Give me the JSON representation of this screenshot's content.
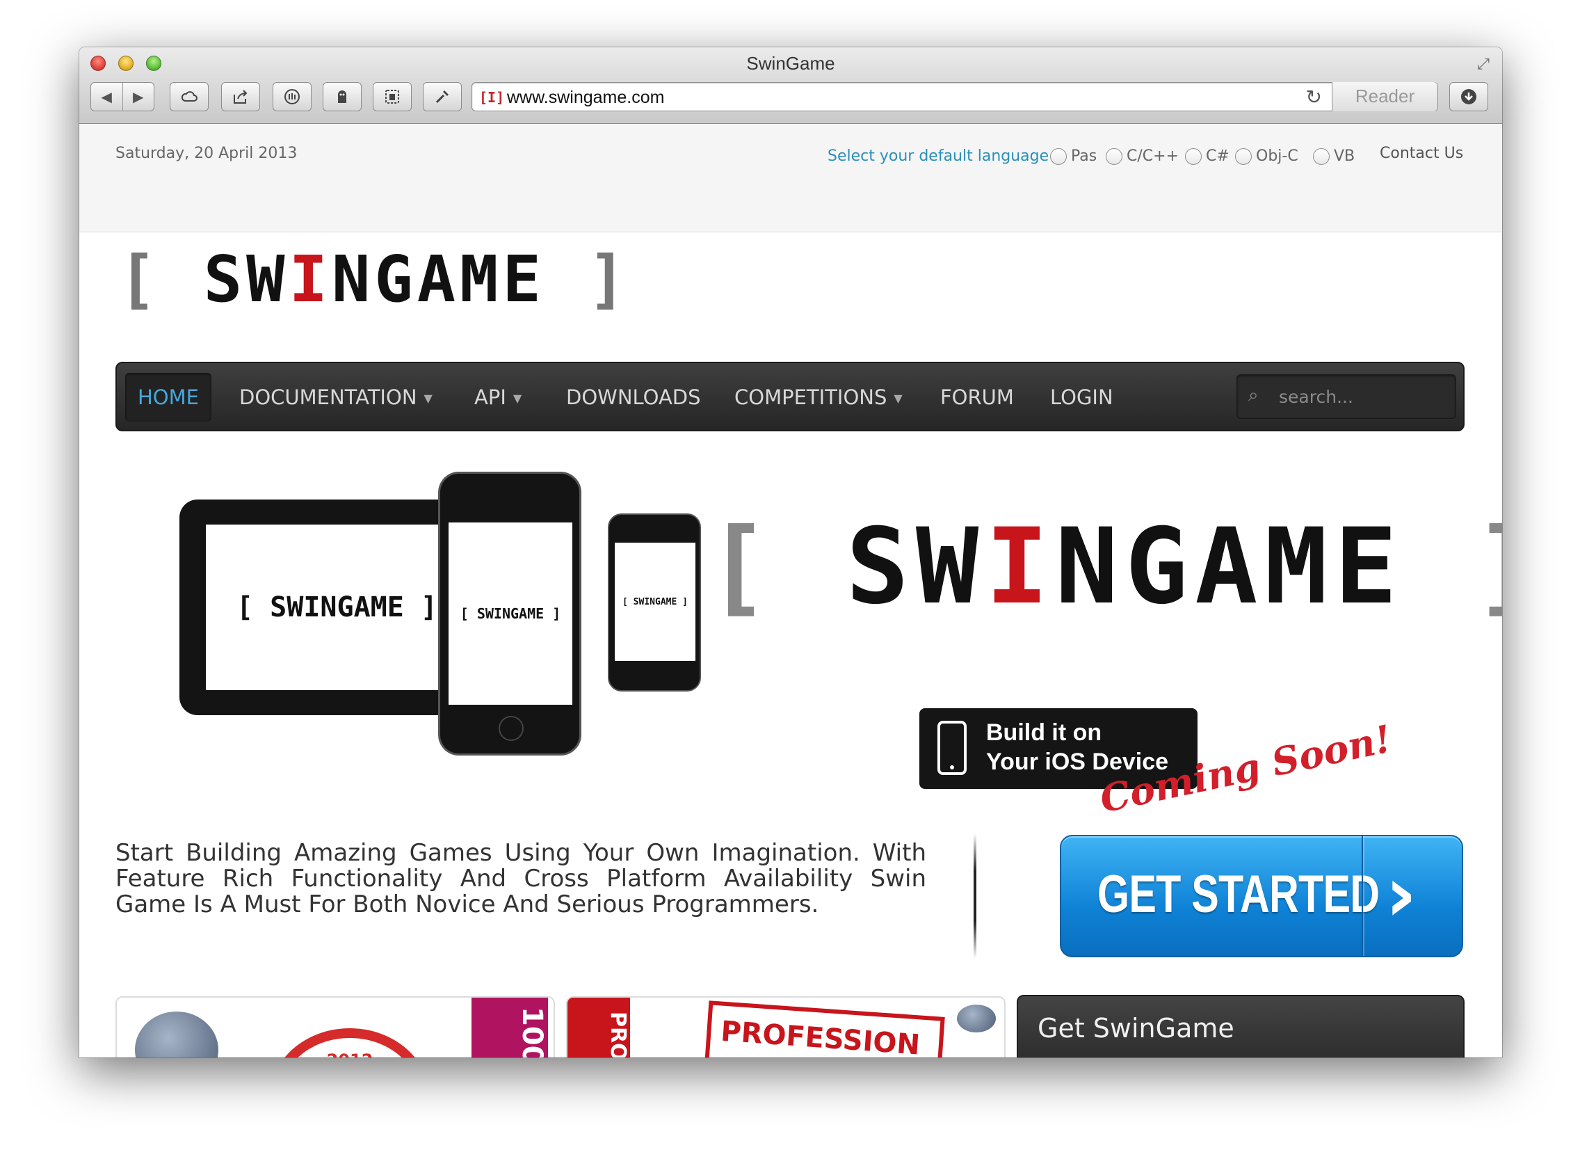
{
  "browser": {
    "window_title": "SwinGame",
    "url": "www.swingame.com",
    "favicon_text": "[I]",
    "reader_label": "Reader",
    "toolbar_icons": [
      "back-icon",
      "forward-icon",
      "icloud-icon",
      "share-icon",
      "stop-icon",
      "extension-icon",
      "evernote-icon",
      "tools-icon",
      "reload-icon",
      "downloads-icon",
      "fullscreen-icon"
    ]
  },
  "topbar": {
    "date": "Saturday, 20 April 2013",
    "language_prompt": "Select your default language",
    "languages": [
      "Pas",
      "C/C++",
      "C#",
      "Obj-C",
      "VB"
    ],
    "contact": "Contact Us"
  },
  "logo": {
    "open": "[ ",
    "part1": "SW",
    "accent": "I",
    "part2": "NGAME",
    "close": " ]"
  },
  "nav": {
    "items": [
      {
        "label": "HOME",
        "active": true,
        "dropdown": false
      },
      {
        "label": "DOCUMENTATION",
        "active": false,
        "dropdown": true
      },
      {
        "label": "API",
        "active": false,
        "dropdown": true
      },
      {
        "label": "DOWNLOADS",
        "active": false,
        "dropdown": false
      },
      {
        "label": "COMPETITIONS",
        "active": false,
        "dropdown": true
      },
      {
        "label": "FORUM",
        "active": false,
        "dropdown": false
      },
      {
        "label": "LOGIN",
        "active": false,
        "dropdown": false
      }
    ],
    "search_placeholder": "search..."
  },
  "banner": {
    "ios_line1": "Build it on",
    "ios_line2": "Your iOS Device",
    "coming_soon": "Coming Soon!",
    "device_logo": "[ SWINGAME ]"
  },
  "intro": {
    "text": "Start Building Amazing Games Using Your Own Imagination. With Feature Rich Functionality And Cross Platform Availability Swin Game Is A Must For Both Novice And Serious Programmers."
  },
  "cta": {
    "label": "GET STARTED",
    "arrow": "›"
  },
  "sidebar": {
    "title": "Get SwinGame"
  },
  "cards": {
    "badge_text": "2012",
    "card2_text": "PROFESSION",
    "card2_side": "PRO",
    "card1_side": "100"
  },
  "colors": {
    "accent_blue": "#46a7d8",
    "brand_red": "#c8141b",
    "cta_blue": "#1a8fe0",
    "nav_dark": "#2f2f2f"
  }
}
